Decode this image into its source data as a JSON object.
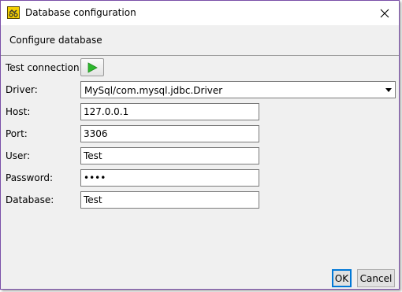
{
  "window": {
    "title": "Database configuration",
    "close_icon": "close-icon"
  },
  "header": {
    "text": "Configure database"
  },
  "form": {
    "test_connection": {
      "label": "Test connection:",
      "icon": "play-icon",
      "icon_color": "#2eb82e"
    },
    "driver": {
      "label": "Driver:",
      "value": "MySql/com.mysql.jdbc.Driver"
    },
    "host": {
      "label": "Host:",
      "value": "127.0.0.1"
    },
    "port": {
      "label": "Port:",
      "value": "3306"
    },
    "user": {
      "label": "User:",
      "value": "Test"
    },
    "password": {
      "label": "Password:",
      "value": "Test"
    },
    "database": {
      "label": "Database:",
      "value": "Test"
    }
  },
  "buttons": {
    "ok": "OK",
    "cancel": "Cancel"
  },
  "colors": {
    "window_border": "#7a4fa8",
    "accent": "#0078d7"
  }
}
